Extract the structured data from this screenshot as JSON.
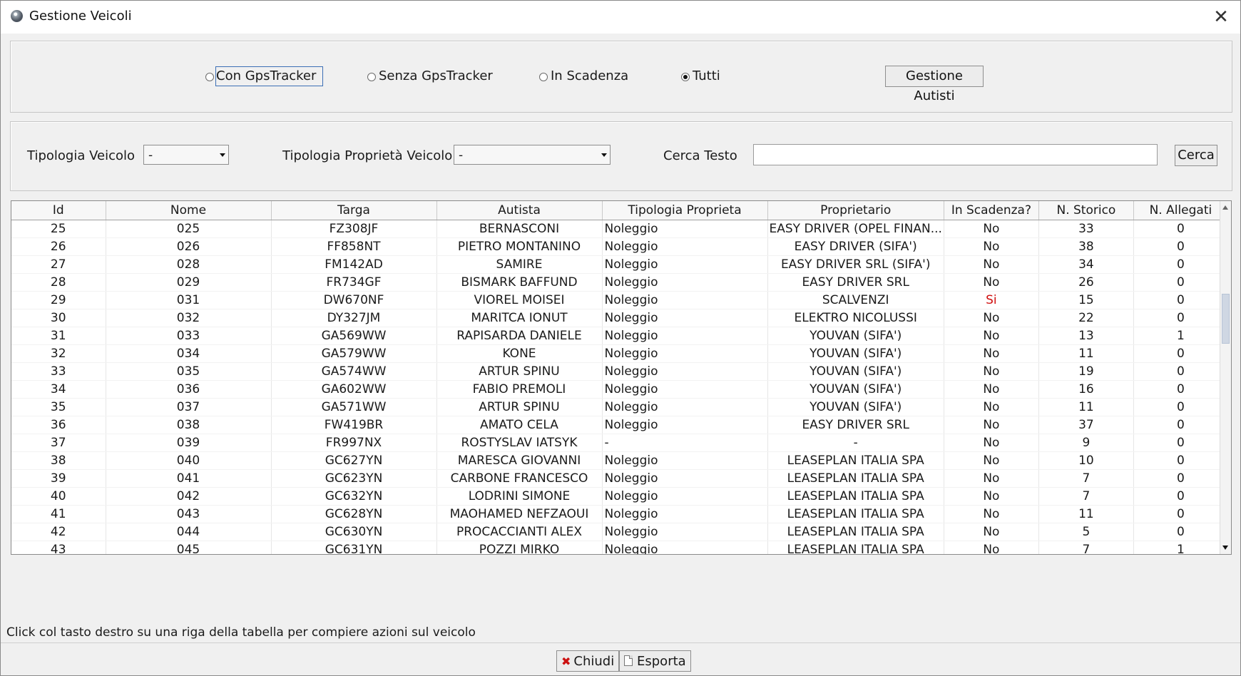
{
  "window": {
    "title": "Gestione Veicoli",
    "close_glyph": "✕"
  },
  "filters": {
    "radios": [
      {
        "label": "Con GpsTracker",
        "selected": false,
        "focused": true
      },
      {
        "label": "Senza GpsTracker",
        "selected": false,
        "focused": false
      },
      {
        "label": "In Scadenza",
        "selected": false,
        "focused": false
      },
      {
        "label": "Tutti",
        "selected": true,
        "focused": false
      }
    ],
    "manage_drivers_label": "Gestione Autisti"
  },
  "search": {
    "vehicle_type_label": "Tipologia Veicolo",
    "vehicle_type_value": "-",
    "ownership_type_label": "Tipologia Proprietà Veicolo",
    "ownership_type_value": "-",
    "text_label": "Cerca Testo",
    "text_value": "",
    "search_button": "Cerca"
  },
  "table": {
    "columns": [
      "Id",
      "Nome",
      "Targa",
      "Autista",
      "Tipologia Proprieta",
      "Proprietario",
      "In Scadenza?",
      "N. Storico",
      "N. Allegati"
    ],
    "rows": [
      [
        "25",
        "025",
        "FZ308JF",
        "BERNASCONI",
        "Noleggio",
        "EASY DRIVER (OPEL FINAN...",
        "No",
        "33",
        "0"
      ],
      [
        "26",
        "026",
        "FF858NT",
        "PIETRO MONTANINO",
        "Noleggio",
        "EASY DRIVER (SIFA')",
        "No",
        "38",
        "0"
      ],
      [
        "27",
        "028",
        "FM142AD",
        "SAMIRE",
        "Noleggio",
        "EASY DRIVER SRL (SIFA')",
        "No",
        "34",
        "0"
      ],
      [
        "28",
        "029",
        "FR734GF",
        "BISMARK BAFFUND",
        "Noleggio",
        "EASY DRIVER SRL",
        "No",
        "26",
        "0"
      ],
      [
        "29",
        "031",
        "DW670NF",
        "VIOREL MOISEI",
        "Noleggio",
        "SCALVENZI",
        "Si",
        "15",
        "0"
      ],
      [
        "30",
        "032",
        "DY327JM",
        "MARITCA IONUT",
        "Noleggio",
        "ELEKTRO NICOLUSSI",
        "No",
        "22",
        "0"
      ],
      [
        "31",
        "033",
        "GA569WW",
        "RAPISARDA DANIELE",
        "Noleggio",
        "YOUVAN (SIFA')",
        "No",
        "13",
        "1"
      ],
      [
        "32",
        "034",
        "GA579WW",
        "KONE",
        "Noleggio",
        "YOUVAN (SIFA')",
        "No",
        "11",
        "0"
      ],
      [
        "33",
        "035",
        "GA574WW",
        "ARTUR SPINU",
        "Noleggio",
        "YOUVAN (SIFA')",
        "No",
        "19",
        "0"
      ],
      [
        "34",
        "036",
        "GA602WW",
        "FABIO PREMOLI",
        "Noleggio",
        "YOUVAN (SIFA')",
        "No",
        "16",
        "0"
      ],
      [
        "35",
        "037",
        "GA571WW",
        "ARTUR SPINU",
        "Noleggio",
        "YOUVAN (SIFA')",
        "No",
        "11",
        "0"
      ],
      [
        "36",
        "038",
        "FW419BR",
        "AMATO CELA",
        "Noleggio",
        "EASY DRIVER SRL",
        "No",
        "37",
        "0"
      ],
      [
        "37",
        "039",
        "FR997NX",
        "ROSTYSLAV IATSYK",
        "-",
        "-",
        "No",
        "9",
        "0"
      ],
      [
        "38",
        "040",
        "GC627YN",
        "MARESCA GIOVANNI",
        "Noleggio",
        "LEASEPLAN ITALIA SPA",
        "No",
        "10",
        "0"
      ],
      [
        "39",
        "041",
        "GC623YN",
        "CARBONE FRANCESCO",
        "Noleggio",
        "LEASEPLAN ITALIA SPA",
        "No",
        "7",
        "0"
      ],
      [
        "40",
        "042",
        "GC632YN",
        "LODRINI SIMONE",
        "Noleggio",
        "LEASEPLAN ITALIA SPA",
        "No",
        "7",
        "0"
      ],
      [
        "41",
        "043",
        "GC628YN",
        "MAOHAMED NEFZAOUI",
        "Noleggio",
        "LEASEPLAN ITALIA SPA",
        "No",
        "11",
        "0"
      ],
      [
        "42",
        "044",
        "GC630YN",
        "PROCACCIANTI ALEX",
        "Noleggio",
        "LEASEPLAN ITALIA SPA",
        "No",
        "5",
        "0"
      ],
      [
        "43",
        "045",
        "GC631YN",
        "POZZI MIRKO",
        "Noleggio",
        "LEASEPLAN ITALIA SPA",
        "No",
        "7",
        "1"
      ]
    ],
    "alert_color": "#d01010"
  },
  "hint": "Click col tasto destro su una riga della tabella per compiere azioni sul veicolo",
  "footer": {
    "close_label": "Chiudi",
    "export_label": "Esporta"
  }
}
